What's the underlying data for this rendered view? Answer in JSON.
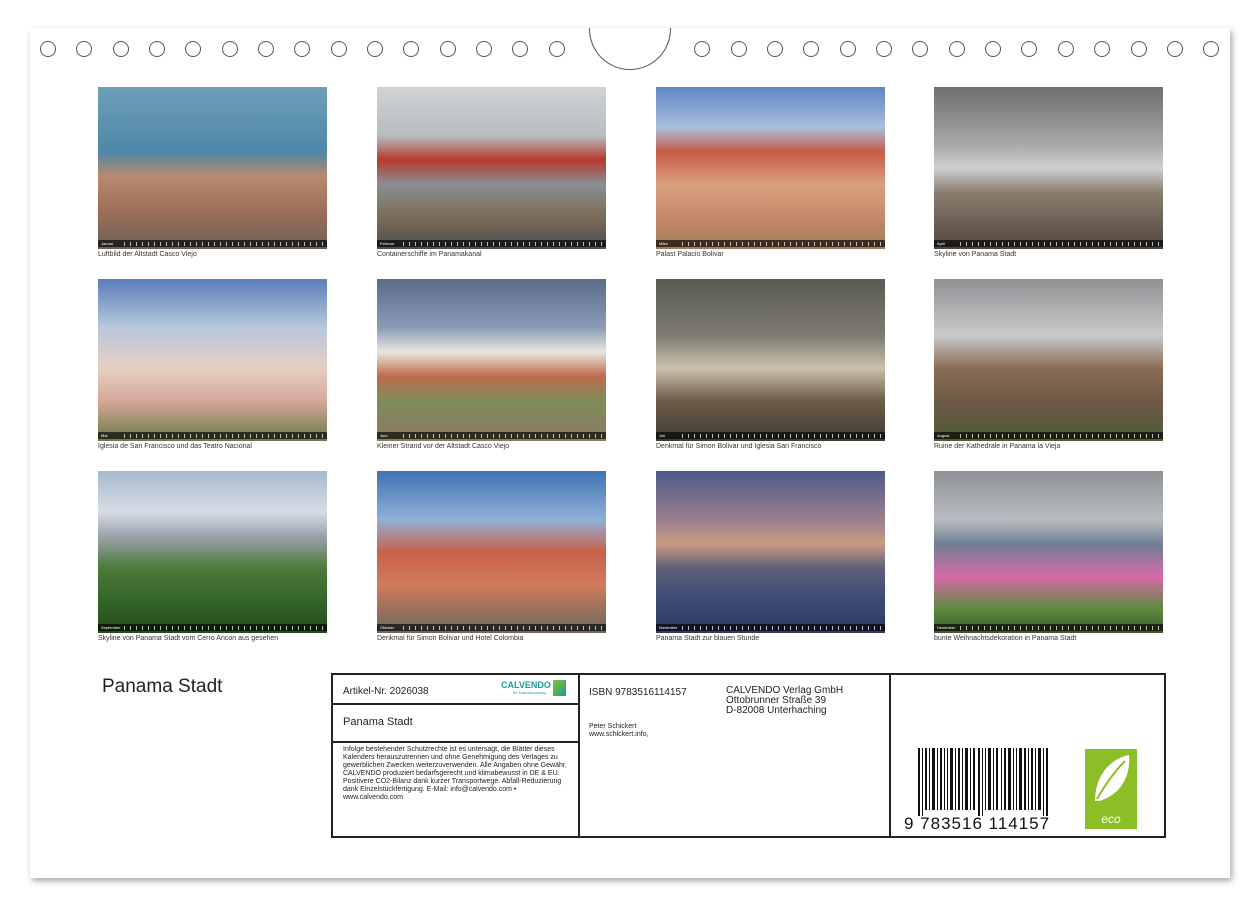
{
  "calendar": {
    "title": "Panama Stadt",
    "months": [
      {
        "strip": "Januar",
        "caption": "Luftbild der Altstadt Casco Viejo"
      },
      {
        "strip": "Februar",
        "caption": "Containerschiffe im Panamakanal"
      },
      {
        "strip": "März",
        "caption": "Palast Palacio Bolivar"
      },
      {
        "strip": "April",
        "caption": "Skyline von Panama Stadt"
      },
      {
        "strip": "Mai",
        "caption": "Iglesia de San Francisco und das Teatro Nacional"
      },
      {
        "strip": "Juni",
        "caption": "Kleiner Strand vor der Altstadt Casco Viejo"
      },
      {
        "strip": "Juli",
        "caption": "Denkmal für Simon Bolivar und Iglesia San Francisco"
      },
      {
        "strip": "August",
        "caption": "Ruine der Kathedrale in Panama la Vieja"
      },
      {
        "strip": "September",
        "caption": "Skyline von Panama Stadt vom Cerro Ancon aus gesehen"
      },
      {
        "strip": "Oktober",
        "caption": "Denkmal für Simon Bolivar und Hotel Colombia"
      },
      {
        "strip": "November",
        "caption": "Panama Stadt zur blauen Stunde"
      },
      {
        "strip": "Dezember",
        "caption": "bunte Weihnachtsdekoration in Panama Stadt"
      }
    ]
  },
  "info": {
    "article": "Artikel-Nr. 2026038",
    "logo_text": "CALVENDO",
    "logo_sub": "Ihr Kalenderverlag",
    "box_title": "Panama Stadt",
    "legal": "Infolge bestehender Schutzrechte ist es untersagt, die Blätter dieses Kalenders herauszutrennen und ohne Genehmigung des Verlages zu gewerblichen Zwecken weiterzuverwenden. Alle Angaben ohne Gewähr. CALVENDO produziert bedarfsgerecht und klimabewusst in DE & EU. Positivere CO2-Bilanz dank kurzer Transportwege. Abfall-Reduzierung dank Einzelstückfertigung. E-Mail: info@calvendo.com • www.calvendo.com",
    "isbn": "ISBN 9783516114157",
    "publisher_line1": "CALVENDO Verlag GmbH",
    "publisher_line2": "Ottobrunner Straße 39",
    "publisher_line3": "D-82008 Unterhaching",
    "author": "Peter Schickert",
    "author_site": "www.schickert.info,",
    "barcode_number": "9 783516 114157",
    "eco_label": "eco"
  },
  "colors": {
    "eco_green": "#8cbf26",
    "calvendo_teal": "#1a9c9a"
  }
}
